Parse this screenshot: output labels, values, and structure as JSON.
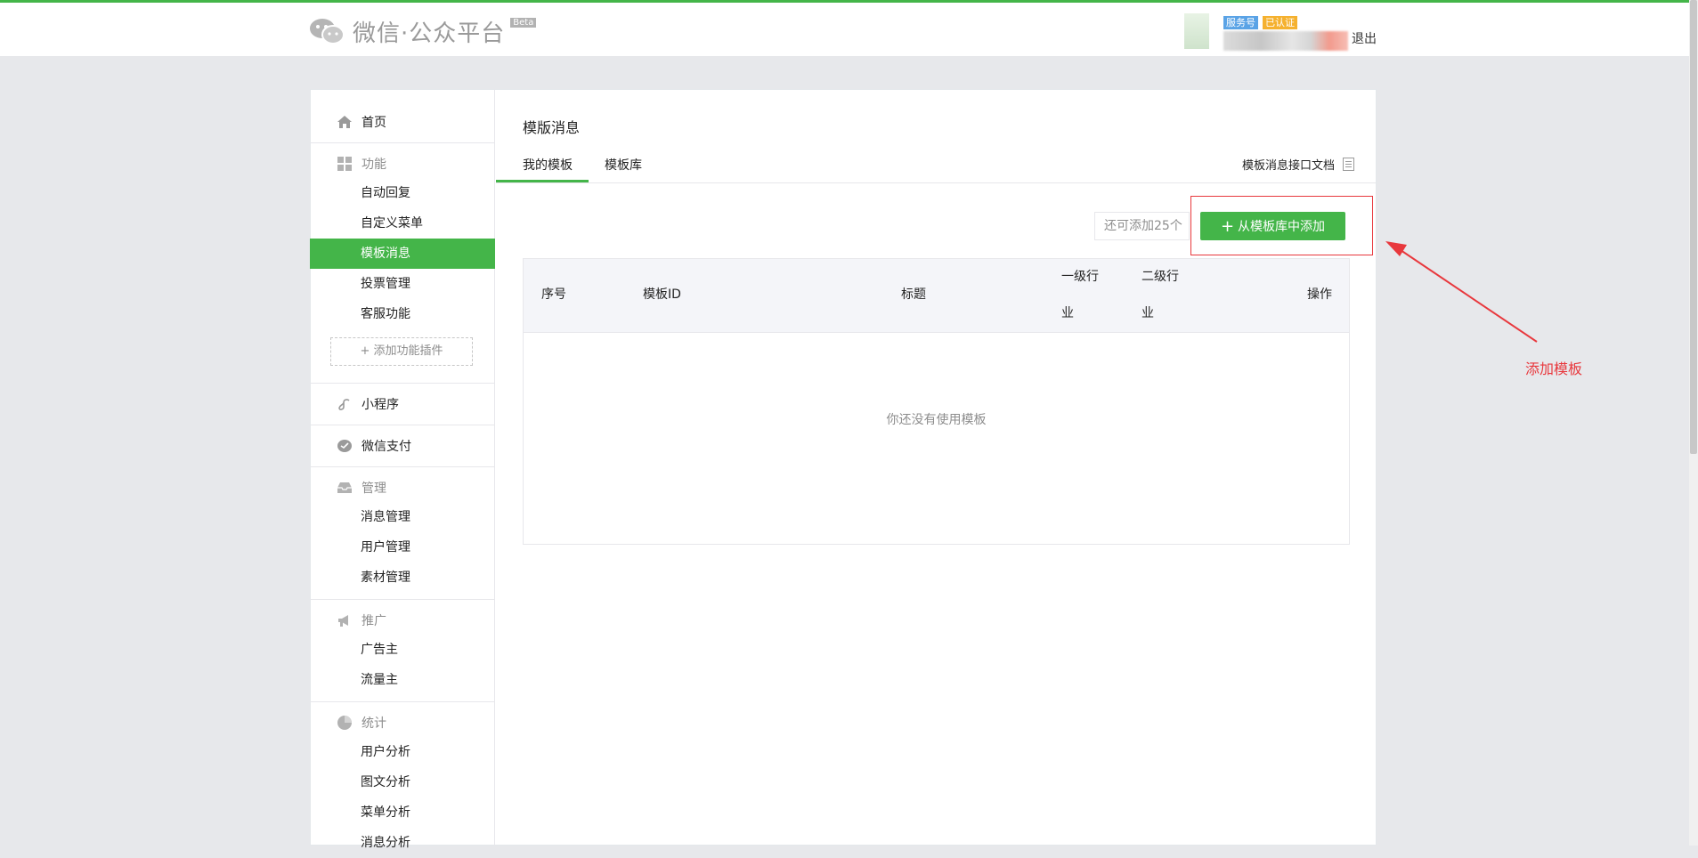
{
  "header": {
    "logo_text": "微信·公众平台",
    "beta": "Beta",
    "account_tag_service": "服务号",
    "account_tag_verified": "已认证",
    "logout": "退出"
  },
  "sidebar": {
    "home": "首页",
    "features": "功能",
    "auto_reply": "自动回复",
    "custom_menu": "自定义菜单",
    "template_msg": "模板消息",
    "vote_mgmt": "投票管理",
    "customer_service": "客服功能",
    "add_plugin": "添加功能插件",
    "mini_program": "小程序",
    "wechat_pay": "微信支付",
    "management": "管理",
    "msg_mgmt": "消息管理",
    "user_mgmt": "用户管理",
    "material_mgmt": "素材管理",
    "promotion": "推广",
    "advertiser": "广告主",
    "traffic_owner": "流量主",
    "statistics": "统计",
    "user_analysis": "用户分析",
    "article_analysis": "图文分析",
    "menu_analysis": "菜单分析",
    "message_analysis": "消息分析"
  },
  "main": {
    "title": "模版消息",
    "tab_mine": "我的模板",
    "tab_library": "模板库",
    "doc_link": "模板消息接口文档",
    "quota": "还可添加25个",
    "add_button": "从模板库中添加",
    "table": {
      "col_index": "序号",
      "col_template_id": "模板ID",
      "col_title": "标题",
      "col_primary_industry_1": "一级行",
      "col_primary_industry_2": "业",
      "col_secondary_industry_1": "二级行",
      "col_secondary_industry_2": "业",
      "col_action": "操作",
      "empty_text": "你还没有使用模板"
    }
  },
  "annotation": {
    "label": "添加模板",
    "color": "#e8383d"
  },
  "colors": {
    "accent": "#44b549",
    "page_bg": "#e7e8eb"
  }
}
